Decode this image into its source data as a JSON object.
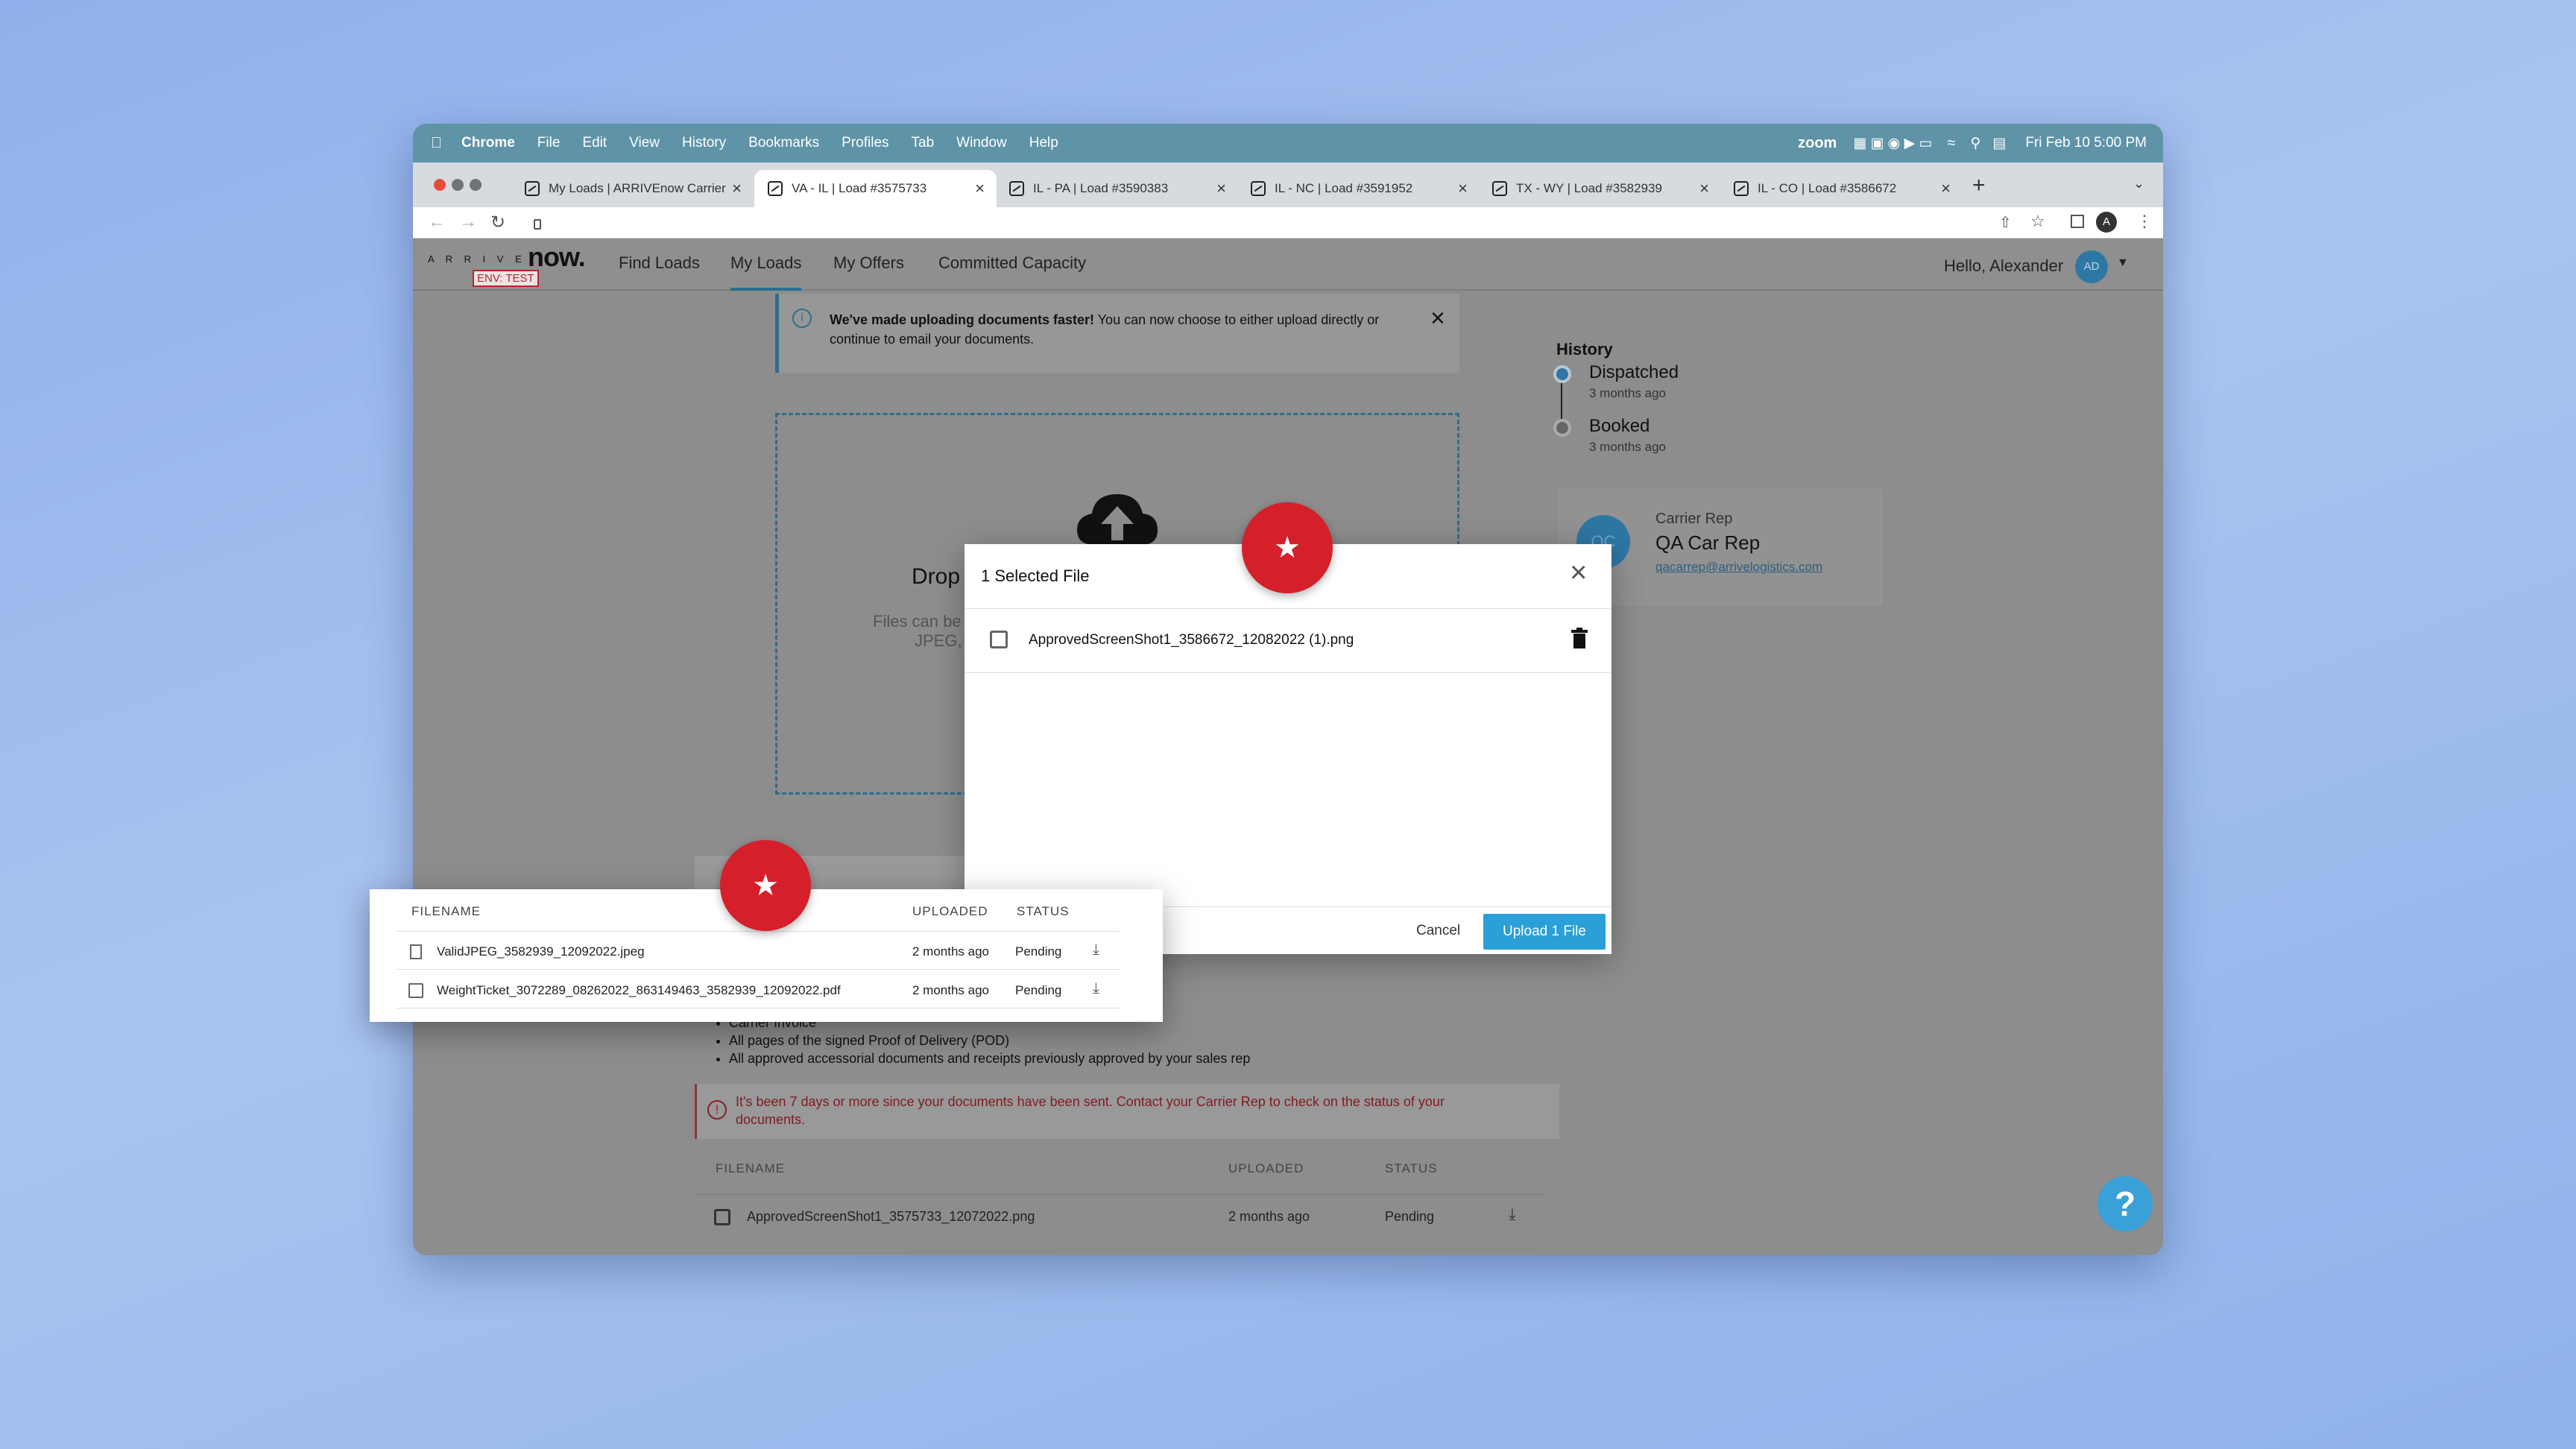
{
  "menubar": {
    "app": "Chrome",
    "items": [
      "File",
      "Edit",
      "View",
      "History",
      "Bookmarks",
      "Profiles",
      "Tab",
      "Window",
      "Help"
    ],
    "zoom": "zoom",
    "clock": "Fri Feb 10  5:00 PM"
  },
  "tabs": [
    {
      "title": "My Loads | ARRIVEnow Carrier",
      "active": false
    },
    {
      "title": "VA - IL | Load #3575733",
      "active": true
    },
    {
      "title": "IL - PA | Load #3590383",
      "active": false
    },
    {
      "title": "IL - NC | Load #3591952",
      "active": false
    },
    {
      "title": "TX - WY | Load #3582939",
      "active": false
    },
    {
      "title": "IL - CO | Load #3586672",
      "active": false
    }
  ],
  "browser": {
    "profile_initial": "A"
  },
  "app": {
    "logo_letters": "A R R I V E",
    "logo_now": "now.",
    "env": "ENV: TEST",
    "nav": [
      "Find Loads",
      "My Loads",
      "My Offers",
      "Committed Capacity"
    ],
    "active_nav": "My Loads",
    "greeting": "Hello, Alexander",
    "avatar": "AD"
  },
  "notice": {
    "bold": "We've made uploading documents faster!",
    "text": " You can now choose to either upload directly or continue to email your documents."
  },
  "dropzone": {
    "title": "Drop",
    "line1": "Files can be",
    "line2": "JPEG,"
  },
  "history": {
    "title": "History",
    "items": [
      {
        "label": "Dispatched",
        "time": "3 months ago"
      },
      {
        "label": "Booked",
        "time": "3 months ago"
      }
    ]
  },
  "rep": {
    "initials": "QC",
    "role": "Carrier Rep",
    "name": "QA Car Rep",
    "email": "qacarrep@arrivelogistics.com"
  },
  "requirements": [
    "Carrier Invoice",
    "All pages of the signed Proof of Delivery (POD)",
    "All approved accessorial documents and receipts previously approved by your sales rep"
  ],
  "warning": "It's been 7 days or more since your documents have been sent. Contact your Carrier Rep to check on the status of your documents.",
  "docs": {
    "headers": [
      "FILENAME",
      "UPLOADED",
      "STATUS"
    ],
    "rows": [
      {
        "file": "ApprovedScreenShot1_3575733_12072022.png",
        "uploaded": "2 months ago",
        "status": "Pending"
      }
    ]
  },
  "modal": {
    "title": "1 Selected File",
    "file": "ApprovedScreenShot1_3586672_12082022 (1).png",
    "cancel": "Cancel",
    "upload": "Upload 1 File"
  },
  "popup_table": {
    "headers": [
      "FILENAME",
      "UPLOADED",
      "STATUS"
    ],
    "rows": [
      {
        "file": "ValidJPEG_3582939_12092022.jpeg",
        "uploaded": "2 months ago",
        "status": "Pending"
      },
      {
        "file": "WeightTicket_3072289_08262022_863149463_3582939_12092022.pdf",
        "uploaded": "2 months ago",
        "status": "Pending"
      }
    ]
  },
  "colors": {
    "accent": "#2a9fd8",
    "marker": "#d51f2a",
    "menubar": "#5e93a8",
    "warning_text": "#b3262e"
  }
}
